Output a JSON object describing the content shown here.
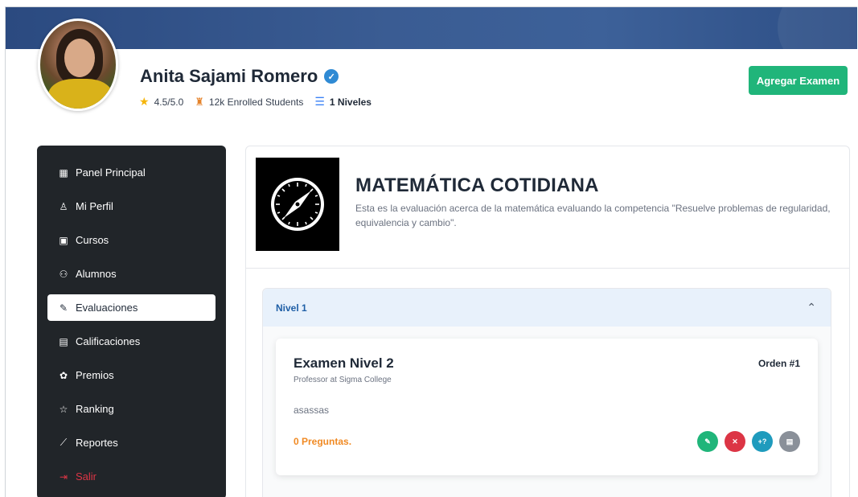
{
  "profile": {
    "name": "Anita Sajami Romero",
    "rating": "4.5/5.0",
    "students": "12k Enrolled Students",
    "levels": "1 Niveles"
  },
  "header": {
    "add_exam_label": "Agregar Examen"
  },
  "sidebar": {
    "items": [
      {
        "label": "Panel Principal",
        "icon": "grid-icon"
      },
      {
        "label": "Mi Perfil",
        "icon": "user-icon"
      },
      {
        "label": "Cursos",
        "icon": "video-icon"
      },
      {
        "label": "Alumnos",
        "icon": "users-icon"
      },
      {
        "label": "Evaluaciones",
        "icon": "edit-icon"
      },
      {
        "label": "Calificaciones",
        "icon": "card-icon"
      },
      {
        "label": "Premios",
        "icon": "award-icon"
      },
      {
        "label": "Ranking",
        "icon": "star-icon"
      },
      {
        "label": "Reportes",
        "icon": "chart-icon"
      },
      {
        "label": "Salir",
        "icon": "logout-icon"
      }
    ],
    "active": "Evaluaciones"
  },
  "course": {
    "title": "MATEMÁTICA COTIDIANA",
    "description": "Esta es la evaluación acerca de la matemática evaluando la competencia \"Resuelve problemas de regularidad, equivalencia y cambio\"."
  },
  "accordion": {
    "title": "Nivel 1"
  },
  "exam": {
    "title": "Examen Nivel 2",
    "subtitle": "Professor at Sigma College",
    "order": "Orden #1",
    "text": "asassas",
    "questions": "0 Preguntas.",
    "add_question_label": "+?"
  },
  "colors": {
    "accent_green": "#20b57a",
    "sidebar_bg": "#212529",
    "danger": "#dc3545",
    "info": "#1f9bbd",
    "warning_text": "#f08a24"
  }
}
